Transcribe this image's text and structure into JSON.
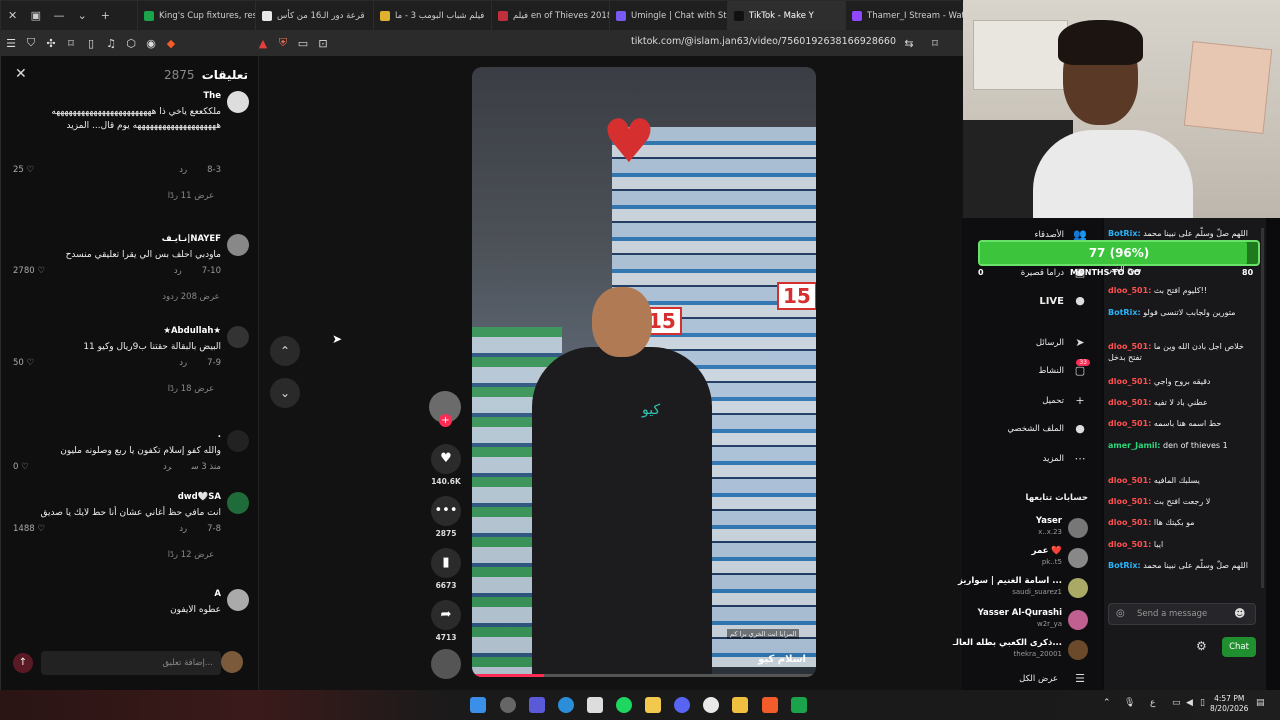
{
  "browser": {
    "tabs": [
      {
        "label": "King's Cup fixtures, resu",
        "color": "#1aa34a"
      },
      {
        "label": "قرعة دور الـ16 من كأس",
        "color": "#e8e8e8"
      },
      {
        "label": "فيلم شباب البومب 3 - ما",
        "color": "#e0b030"
      },
      {
        "label": "فيلم en of Thieves 2018",
        "color": "#c0303a"
      },
      {
        "label": "Umingle | Chat with Stra",
        "color": "#7a5af5"
      },
      {
        "label": "TikTok - Make Y",
        "color": "#111111"
      },
      {
        "label": "Thamer_I Stream - Watc",
        "color": "#9146ff"
      }
    ],
    "url": "tiktok.com/@islam.jan63/video/7560192638166928660"
  },
  "comments": {
    "title": "تعليقات",
    "count": "2875",
    "input_placeholder": "إضافة تعليق...",
    "items": [
      {
        "user": "The",
        "text": "ملككععع ياخي ذا ههههههههههههههههههههههههه ههههههههههههههههههههه يوم قال... المزيد",
        "date": "8-3",
        "reply": "رد",
        "likes": "25",
        "replies": "عرض 11 ردًا"
      },
      {
        "user": "NAYEF|نـايـف",
        "text": "ماودبي احلف بس الي يقرا تعليقي منسدح",
        "date": "7-10",
        "reply": "رد",
        "likes": "2780",
        "replies": "عرض 208 ردود"
      },
      {
        "user": "★Abdullah★",
        "text": "البيض بالبقالة حقتنا ب9ريال وكيو 11",
        "date": "7-9",
        "reply": "رد",
        "likes": "50",
        "replies": "عرض 18 ردًا"
      },
      {
        "user": ".",
        "text": "والله كفو إسلام تكفون يا ربع وصلونه مليون",
        "date": "منذ 3 س",
        "reply": "رد",
        "likes": "0",
        "replies": ""
      },
      {
        "user": "dwd🤍SA",
        "text": "انت مافي حظ أغاني عشان أنا حط لايك يا صديق",
        "date": "7-8",
        "reply": "رد",
        "likes": "1488",
        "replies": "عرض 12 ردًا"
      },
      {
        "user": "A",
        "text": "عطوه الايفون",
        "date": "",
        "reply": "",
        "likes": "",
        "replies": ""
      }
    ]
  },
  "video": {
    "caption": "اسلام كيو",
    "subtitle": "المرايا انت الخري برا كم",
    "logo_text": "كيو",
    "price": "15",
    "progress": 0.21
  },
  "actions": {
    "likes": "140.6K",
    "comments": "2875",
    "saves": "6673",
    "shares": "4713"
  },
  "twitch": {
    "side": [
      {
        "label": "الأصدقاء",
        "icon": "friends-icon",
        "glyph": "👥"
      },
      {
        "label": "دراما قصيرة",
        "icon": "drama-icon",
        "glyph": "▣"
      },
      {
        "label": "LIVE",
        "icon": "live-icon",
        "glyph": "●"
      },
      {
        "label": "الرسائل",
        "icon": "messages-icon",
        "glyph": "➤"
      },
      {
        "label": "النشاط",
        "icon": "activity-icon",
        "glyph": "▢",
        "badge": "33"
      },
      {
        "label": "تحميل",
        "icon": "upload-icon",
        "glyph": "+"
      },
      {
        "label": "الملف الشخصي",
        "icon": "profile-icon",
        "glyph": "●"
      },
      {
        "label": "المزيد",
        "icon": "more-icon",
        "glyph": "⋯"
      }
    ],
    "following_title": "حسابات تتابعها",
    "following": [
      {
        "name": "Yaser",
        "handle": "x..x.23"
      },
      {
        "name": "عمر ❤️",
        "handle": "pk..t5"
      },
      {
        "name": "اسامة الغنيم | سواريز ...",
        "handle": "saudi_suarez1"
      },
      {
        "name": "Yasser Al-Qurashi",
        "handle": "w2r_ya"
      },
      {
        "name": "ذكرى الكعبي بطله العالـ...",
        "handle": "thekra_20001"
      }
    ],
    "show_all": "عرض الكل",
    "goal": {
      "text": "77 (96%)",
      "fraction": 0.96,
      "low": "0",
      "high": "80",
      "title": "MONTHS TO GO"
    },
    "chat": [
      {
        "user": "BotRix:",
        "color": "#2bb3f5",
        "text": "اللهم صلّ وسلّم على نبينا محمد"
      },
      {
        "user": "",
        "color": "#ff4f4f",
        "text": "صبح الخير"
      },
      {
        "user": "dloo_501:",
        "color": "#ff4f4f",
        "text": "كليوم افتح بث!!"
      },
      {
        "user": "BotRix:",
        "color": "#2bb3f5",
        "text": "متورين ولجابب لاتنسى فولو"
      },
      {
        "user": "dloo_501:",
        "color": "#ff4f4f",
        "text": "خلاص اجل بادن الله وين ما تفتح بدخل"
      },
      {
        "user": "dloo_501:",
        "color": "#ff4f4f",
        "text": "دقيقه بروح واجي"
      },
      {
        "user": "dloo_501:",
        "color": "#ff4f4f",
        "text": "عطني باد لا تفيه"
      },
      {
        "user": "dloo_501:",
        "color": "#ff4f4f",
        "text": "حط اسمه هنا باسمه"
      },
      {
        "user": "amer_Jamil:",
        "color": "#2bd67a",
        "text": "den of thieves 1"
      },
      {
        "user": "dloo_501:",
        "color": "#ff4f4f",
        "text": "يسلبك المافيه"
      },
      {
        "user": "dloo_501:",
        "color": "#ff4f4f",
        "text": "لا رجعت افتح بث"
      },
      {
        "user": "dloo_501:",
        "color": "#ff4f4f",
        "text": "مو بكيتك هاا"
      },
      {
        "user": "dloo_501:",
        "color": "#ff4f4f",
        "text": "ايبا"
      },
      {
        "user": "BotRix:",
        "color": "#2bb3f5",
        "text": "اللهم صلّ وسلّم على نبينا محمد"
      }
    ],
    "chat_placeholder": "Send a message",
    "chat_button": "Chat"
  },
  "taskbar": {
    "time": "4:57 PM",
    "date": "8/20/2026",
    "lang": "ع"
  }
}
